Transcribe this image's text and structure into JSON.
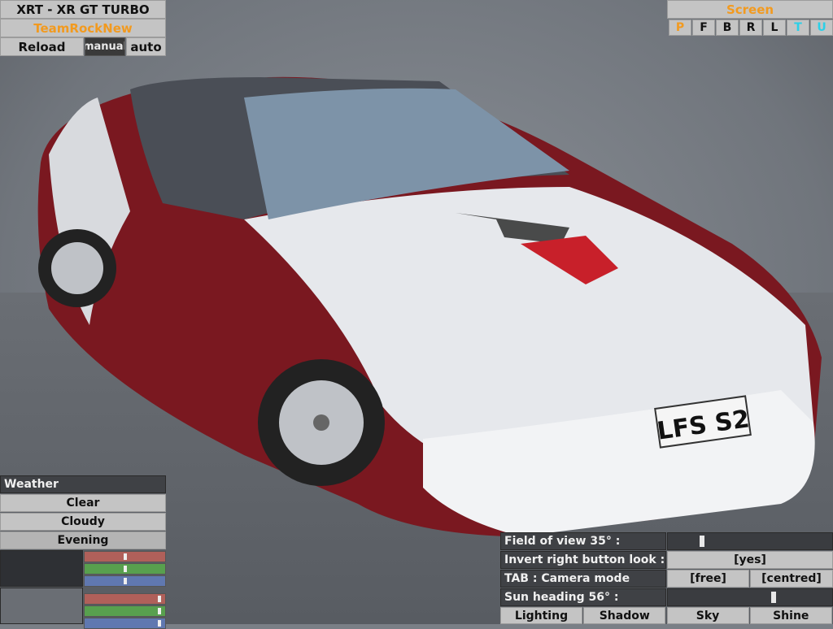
{
  "car": {
    "name": "XRT - XR GT TURBO",
    "skin": "TeamRockNew",
    "reload_label": "Reload",
    "manual_label": "manual",
    "auto_label": "auto",
    "plate_text": "LFS S2"
  },
  "screen": {
    "title": "Screen",
    "letters": [
      {
        "label": "P",
        "color": "#f29a1f"
      },
      {
        "label": "F",
        "color": "#111111"
      },
      {
        "label": "B",
        "color": "#111111"
      },
      {
        "label": "R",
        "color": "#111111"
      },
      {
        "label": "L",
        "color": "#111111"
      },
      {
        "label": "T",
        "color": "#2ad0e8"
      },
      {
        "label": "U",
        "color": "#2ad0e8"
      }
    ]
  },
  "weather": {
    "title": "Weather",
    "options": [
      "Clear",
      "Cloudy",
      "Evening"
    ],
    "selected": "Evening",
    "color_sliders": [
      {
        "color": "#b0605a",
        "level": 0.5
      },
      {
        "color": "#58a04e",
        "level": 0.5
      },
      {
        "color": "#6078b0",
        "level": 0.5
      },
      {
        "color": "#b0605a",
        "level": 0.95
      },
      {
        "color": "#58a04e",
        "level": 0.95
      },
      {
        "color": "#6078b0",
        "level": 0.95
      }
    ]
  },
  "camera": {
    "fov_label": "Field of view 35° :",
    "fov_level": 0.2,
    "invert_label": "Invert right button look :",
    "invert_value": "[yes]",
    "tab_label": "TAB : Camera mode",
    "mode_free": "[free]",
    "mode_centred": "[centred]",
    "sun_label": "Sun heading 56° :",
    "sun_level": 0.65,
    "bottom_buttons": [
      "Lighting",
      "Shadow",
      "Sky",
      "Shine"
    ]
  },
  "colors": {
    "accent_orange": "#f29a1f",
    "accent_cyan": "#2ad0e8",
    "button_gray": "#c4c4c4"
  }
}
